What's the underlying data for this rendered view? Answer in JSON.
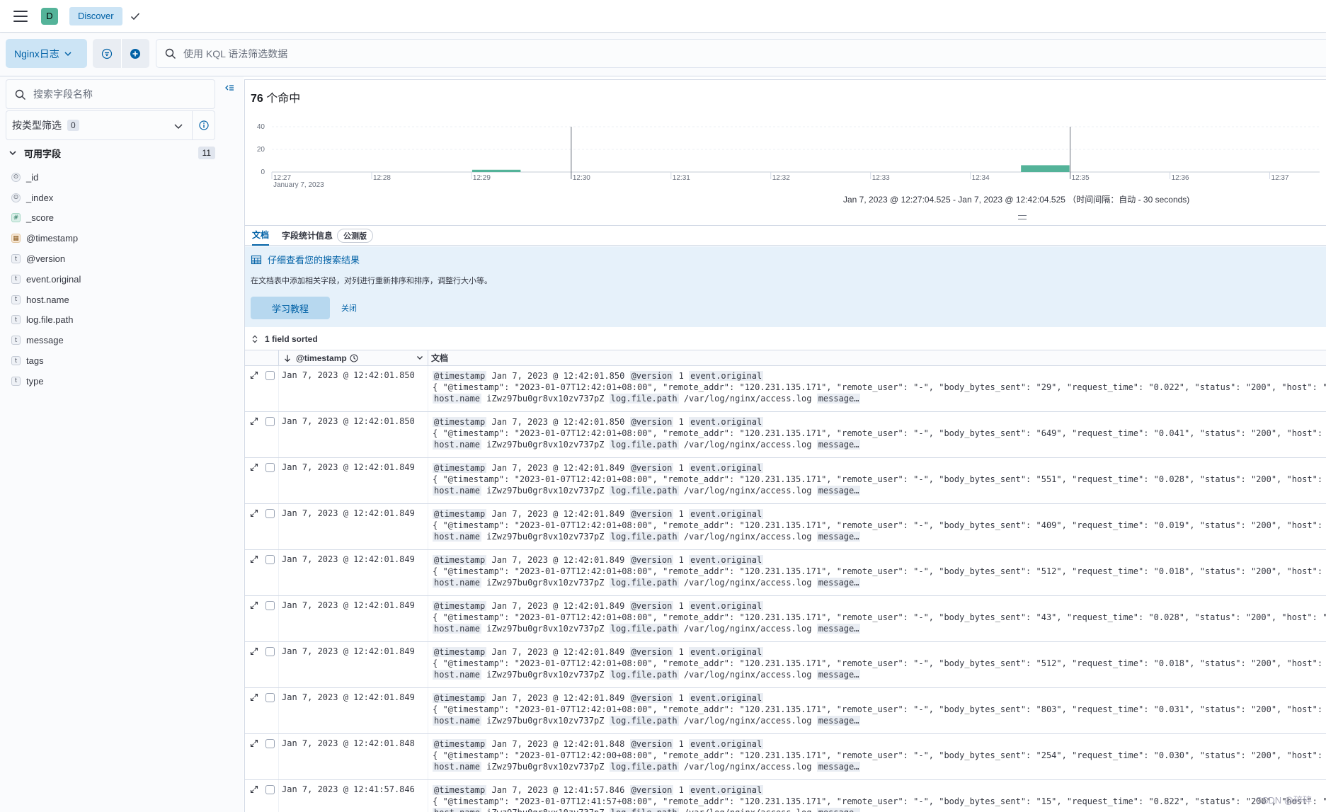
{
  "header": {
    "space_initial": "D",
    "app_name": "Discover"
  },
  "querybar": {
    "data_view": "Nginx日志",
    "kql_placeholder": "使用 KQL 语法筛选数据"
  },
  "sidebar": {
    "search_placeholder": "搜索字段名称",
    "type_filter_label": "按类型筛选",
    "type_filter_count": "0",
    "available_label": "可用字段",
    "available_count": "11",
    "fields": [
      {
        "type": "id",
        "name": "_id"
      },
      {
        "type": "id",
        "name": "_index"
      },
      {
        "type": "number",
        "name": "_score"
      },
      {
        "type": "date",
        "name": "@timestamp"
      },
      {
        "type": "text",
        "name": "@version"
      },
      {
        "type": "text",
        "name": "event.original"
      },
      {
        "type": "text",
        "name": "host.name"
      },
      {
        "type": "text",
        "name": "log.file.path"
      },
      {
        "type": "text",
        "name": "message"
      },
      {
        "type": "text",
        "name": "tags"
      },
      {
        "type": "text",
        "name": "type"
      }
    ]
  },
  "main": {
    "hits_count": "76",
    "hits_label": "个命中",
    "time_range": "Jan 7, 2023 @ 12:27:04.525 - Jan 7, 2023 @ 12:42:04.525 （时间间隔：自动 - 30 seconds)",
    "tabs": [
      {
        "label": "文档",
        "active": true
      },
      {
        "label": "字段统计信息",
        "active": false
      }
    ],
    "beta_badge": "公测版",
    "callout": {
      "title": "仔细查看您的搜索结果",
      "description": "在文档表中添加相关字段，对列进行重新排序和排序，调整行大小等。",
      "learn_button": "学习教程",
      "close_link": "关闭"
    },
    "sort_label": "1 field sorted",
    "columns": {
      "timestamp": "@timestamp",
      "document": "文档"
    }
  },
  "chart_data": {
    "type": "bar",
    "y_ticks": [
      "40",
      "20",
      "0"
    ],
    "ylim": [
      0,
      40
    ],
    "x_ticks": [
      "12:27",
      "12:28",
      "12:29",
      "12:30",
      "12:31",
      "12:32",
      "12:33",
      "12:34",
      "12:35",
      "12:36",
      "12:37"
    ],
    "x_date_label": "January 7, 2023",
    "xlim": [
      "12:27:00",
      "12:37:30"
    ],
    "bars": [
      {
        "start": "12:29:00",
        "end": "12:29:30",
        "value": 2
      },
      {
        "start": "12:34:30",
        "end": "12:35:00",
        "value": 6
      }
    ],
    "markers": [
      "12:30:00",
      "12:35:00"
    ],
    "color": "#54b399"
  },
  "rows": [
    {
      "ts": "Jan 7, 2023 @ 12:42:01.850",
      "version": "1",
      "orig": "{ \"@timestamp\": \"2023-01-07T12:42:01+08:00\", \"remote_addr\": \"120.231.135.171\", \"remote_user\": \"-\", \"body_bytes_sent\": \"29\", \"request_time\": \"0.022\", \"status\": \"200\", \"host\": \"k",
      "host": "iZwz97bu0gr8vx10zv737pZ",
      "path": "/var/log/nginx/access.log"
    },
    {
      "ts": "Jan 7, 2023 @ 12:42:01.850",
      "version": "1",
      "orig": "{ \"@timestamp\": \"2023-01-07T12:42:01+08:00\", \"remote_addr\": \"120.231.135.171\", \"remote_user\": \"-\", \"body_bytes_sent\": \"649\", \"request_time\": \"0.041\", \"status\": \"200\", \"host\": \"",
      "host": "iZwz97bu0gr8vx10zv737pZ",
      "path": "/var/log/nginx/access.log"
    },
    {
      "ts": "Jan 7, 2023 @ 12:42:01.849",
      "version": "1",
      "orig": "{ \"@timestamp\": \"2023-01-07T12:42:01+08:00\", \"remote_addr\": \"120.231.135.171\", \"remote_user\": \"-\", \"body_bytes_sent\": \"551\", \"request_time\": \"0.028\", \"status\": \"200\", \"host\": \"",
      "host": "iZwz97bu0gr8vx10zv737pZ",
      "path": "/var/log/nginx/access.log"
    },
    {
      "ts": "Jan 7, 2023 @ 12:42:01.849",
      "version": "1",
      "orig": "{ \"@timestamp\": \"2023-01-07T12:42:01+08:00\", \"remote_addr\": \"120.231.135.171\", \"remote_user\": \"-\", \"body_bytes_sent\": \"409\", \"request_time\": \"0.019\", \"status\": \"200\", \"host\": \"",
      "host": "iZwz97bu0gr8vx10zv737pZ",
      "path": "/var/log/nginx/access.log"
    },
    {
      "ts": "Jan 7, 2023 @ 12:42:01.849",
      "version": "1",
      "orig": "{ \"@timestamp\": \"2023-01-07T12:42:01+08:00\", \"remote_addr\": \"120.231.135.171\", \"remote_user\": \"-\", \"body_bytes_sent\": \"512\", \"request_time\": \"0.018\", \"status\": \"200\", \"host\": \"",
      "host": "iZwz97bu0gr8vx10zv737pZ",
      "path": "/var/log/nginx/access.log"
    },
    {
      "ts": "Jan 7, 2023 @ 12:42:01.849",
      "version": "1",
      "orig": "{ \"@timestamp\": \"2023-01-07T12:42:01+08:00\", \"remote_addr\": \"120.231.135.171\", \"remote_user\": \"-\", \"body_bytes_sent\": \"43\", \"request_time\": \"0.028\", \"status\": \"200\", \"host\": \"k",
      "host": "iZwz97bu0gr8vx10zv737pZ",
      "path": "/var/log/nginx/access.log"
    },
    {
      "ts": "Jan 7, 2023 @ 12:42:01.849",
      "version": "1",
      "orig": "{ \"@timestamp\": \"2023-01-07T12:42:01+08:00\", \"remote_addr\": \"120.231.135.171\", \"remote_user\": \"-\", \"body_bytes_sent\": \"512\", \"request_time\": \"0.018\", \"status\": \"200\", \"host\": \"",
      "host": "iZwz97bu0gr8vx10zv737pZ",
      "path": "/var/log/nginx/access.log"
    },
    {
      "ts": "Jan 7, 2023 @ 12:42:01.849",
      "version": "1",
      "orig": "{ \"@timestamp\": \"2023-01-07T12:42:01+08:00\", \"remote_addr\": \"120.231.135.171\", \"remote_user\": \"-\", \"body_bytes_sent\": \"803\", \"request_time\": \"0.031\", \"status\": \"200\", \"host\": \"",
      "host": "iZwz97bu0gr8vx10zv737pZ",
      "path": "/var/log/nginx/access.log"
    },
    {
      "ts": "Jan 7, 2023 @ 12:42:01.848",
      "version": "1",
      "orig": "{ \"@timestamp\": \"2023-01-07T12:42:00+08:00\", \"remote_addr\": \"120.231.135.171\", \"remote_user\": \"-\", \"body_bytes_sent\": \"254\", \"request_time\": \"0.030\", \"status\": \"200\", \"host\": \"",
      "host": "iZwz97bu0gr8vx10zv737pZ",
      "path": "/var/log/nginx/access.log"
    },
    {
      "ts": "Jan 7, 2023 @ 12:41:57.846",
      "version": "1",
      "orig": "{ \"@timestamp\": \"2023-01-07T12:41:57+08:00\", \"remote_addr\": \"120.231.135.171\", \"remote_user\": \"-\", \"body_bytes_sent\": \"15\", \"request_time\": \"0.822\", \"status\": \"200\", \"host\": \"k",
      "host": "iZwz97bu0gr8vx10zv737pZ",
      "path": "/var/log/nginx/access.log"
    }
  ],
  "row_labels": {
    "timestamp_key": "@timestamp",
    "version_key": "@version",
    "original_key": "event.original",
    "host_key": "host.name",
    "path_key": "log.file.path",
    "message_key": "message…"
  },
  "watermark": "CSDN @碎碎"
}
